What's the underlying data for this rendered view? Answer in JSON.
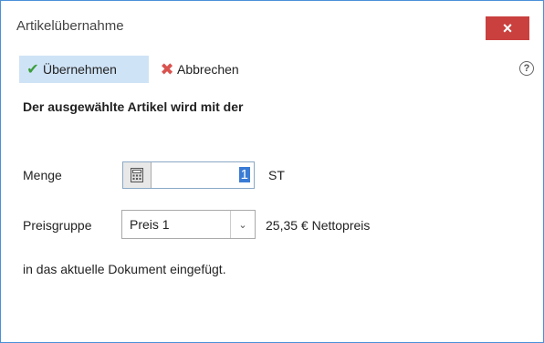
{
  "window": {
    "title": "Artikelübernahme",
    "close_label": "×"
  },
  "toolbar": {
    "apply_label": "Übernehmen",
    "cancel_label": "Abbrechen",
    "help_label": "?"
  },
  "content": {
    "description_line1": "Der ausgewählte Artikel wird mit der",
    "quantity_label": "Menge",
    "quantity_value": "1",
    "unit": "ST",
    "price_group_label": "Preisgruppe",
    "price_group_value": "Preis 1",
    "price_info": "25,35 € Nettopreis",
    "description_line2": "in das aktuelle Dokument eingefügt."
  },
  "colors": {
    "close_bg": "#c9403f",
    "apply_bg": "#cfe3f6",
    "border": "#4a90d9"
  },
  "icons": {
    "apply": "check-icon",
    "cancel": "x-icon",
    "help": "help-icon",
    "calculator": "calculator-icon"
  }
}
